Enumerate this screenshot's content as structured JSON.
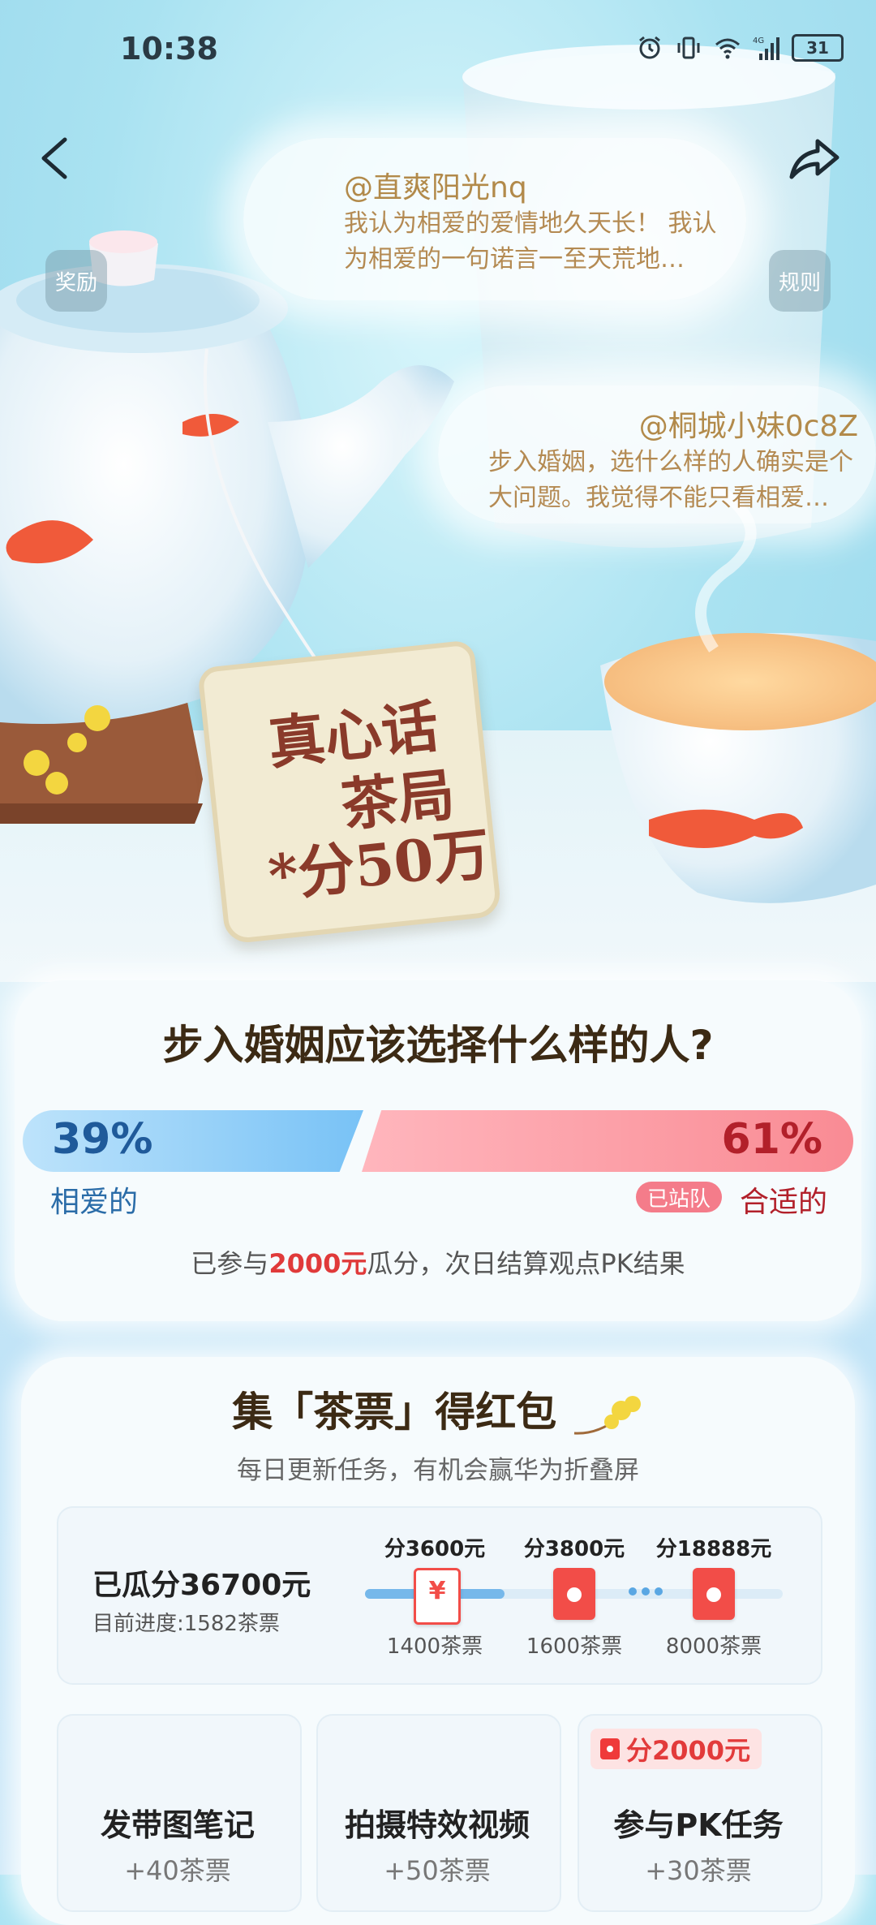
{
  "status": {
    "time": "10:38",
    "network": "4G",
    "battery": "31"
  },
  "nav": {
    "reward_label": "奖励",
    "rules_label": "规则"
  },
  "comments": [
    {
      "user": "@直爽阳光nq",
      "text": "我认为相爱的爱情地久天长！ 我认为相爱的一句诺言一至天荒地…"
    },
    {
      "user": "@桐城小妹0c8Z",
      "text": "步入婚姻，选什么样的人确实是个大问题。我觉得不能只看相爱…"
    }
  ],
  "hero": {
    "line1": "真心话",
    "line2": "茶局",
    "line3": "*分50万"
  },
  "vote": {
    "question": "步入婚姻应该选择什么样的人?",
    "left": {
      "percent": "39%",
      "label": "相爱的",
      "value": 39
    },
    "right": {
      "percent": "61%",
      "label": "合适的",
      "value": 61,
      "badge": "已站队"
    },
    "note_prefix": "已参与",
    "note_amount": "2000元",
    "note_suffix": "瓜分，次日结算观点PK结果"
  },
  "tasks": {
    "title": "集「茶票」得红包",
    "subtitle": "每日更新任务，有机会赢华为折叠屏",
    "total": "已瓜分36700元",
    "progress": "目前进度:1582茶票",
    "milestones": [
      {
        "amount": "分3600元",
        "requirement": "1400茶票"
      },
      {
        "amount": "分3800元",
        "requirement": "1600茶票"
      },
      {
        "amount": "分18888元",
        "requirement": "8000茶票"
      }
    ],
    "items": [
      {
        "title": "发带图笔记",
        "reward": "+40茶票"
      },
      {
        "title": "拍摄特效视频",
        "reward": "+50茶票"
      },
      {
        "title": "参与PK任务",
        "reward": "+30茶票",
        "badge": "分2000元"
      }
    ]
  },
  "colors": {
    "accent_blue": "#78c2f6",
    "accent_red": "#f98b94",
    "highlight": "#e03a3a"
  }
}
